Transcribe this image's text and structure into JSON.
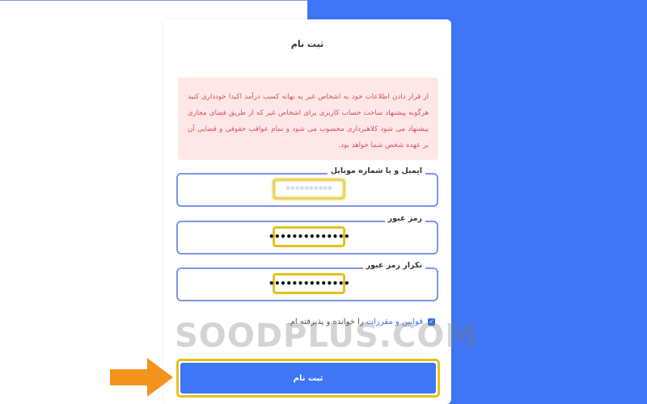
{
  "form": {
    "title": "ثبت نام",
    "warning": "از قرار دادن اطلاعات خود به اشخاص غیر به بهانه کسب درآمد اکیدا خودداری کنید هرگونه پیشنهاد ساخت حساب کاربری برای اشخاص غیر که از طریق فضای مجازی پیشنهاد می شود کلاهبرداری محسوب می شود و تمام عواقب حقوقی و قضایی آن بر عهده شخص شما خواهد بود.",
    "fields": [
      {
        "label": "ایمیل و یا شماره موبایل",
        "value": "••••••••••"
      },
      {
        "label": "رمز عبور",
        "value": "••••••••••••••"
      },
      {
        "label": "تکرار رمز عبور",
        "value": "••••••••••••••"
      }
    ],
    "agree_link": "قوانین و مقررات",
    "agree_text": "را خوانده و پذیرفته ام.",
    "submit_label": "ثبت نام"
  },
  "watermark": "SOODPLUS.COM",
  "colors": {
    "accent": "#3f76f6",
    "highlight": "#e4c21e",
    "alert_bg": "#fde7e7",
    "alert_text": "#d05656",
    "arrow": "#f4921e"
  }
}
